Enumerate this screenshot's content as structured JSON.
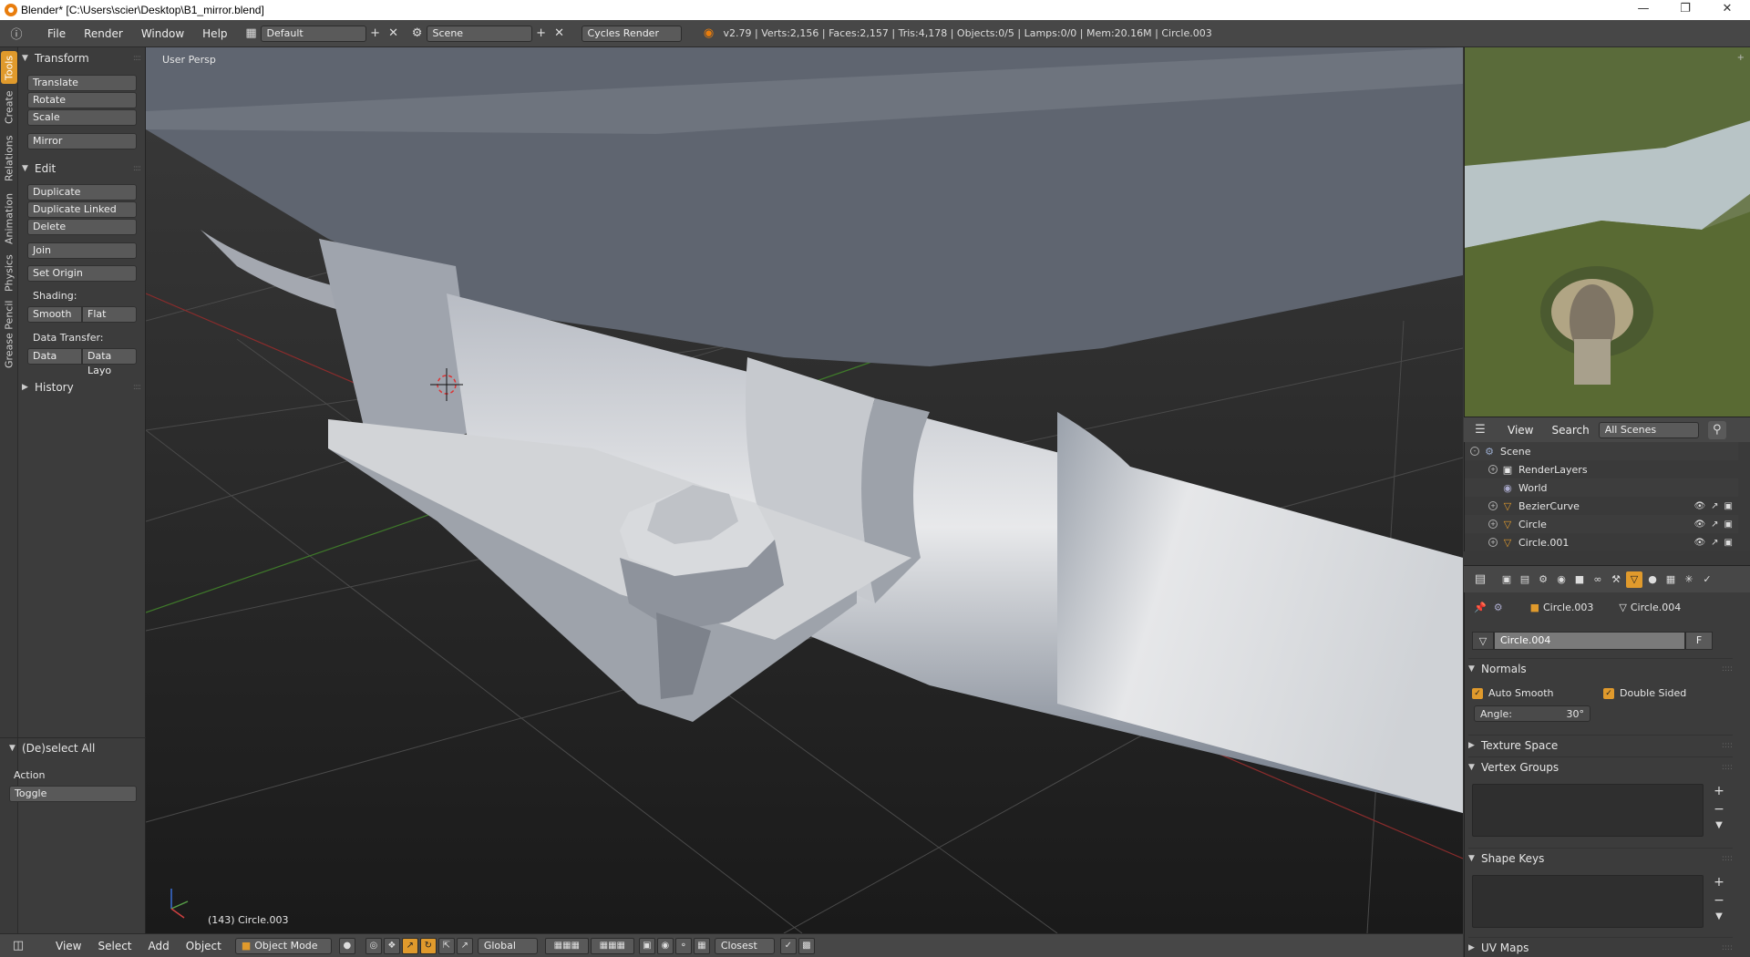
{
  "window": {
    "title": "Blender* [C:\\Users\\scier\\Desktop\\B1_mirror.blend]"
  },
  "infobar": {
    "menus": [
      "File",
      "Render",
      "Window",
      "Help"
    ],
    "layout": "Default",
    "scene": "Scene",
    "engine": "Cycles Render",
    "stats": "v2.79 | Verts:2,156 | Faces:2,157 | Tris:4,178 | Objects:0/5 | Lamps:0/0 | Mem:20.16M | Circle.003"
  },
  "lefttabs": [
    "Tools",
    "Create",
    "Relations",
    "Animation",
    "Physics",
    "Grease Pencil"
  ],
  "toolshelf": {
    "transform": {
      "title": "Transform",
      "buttons": [
        "Translate",
        "Rotate",
        "Scale",
        "Mirror"
      ]
    },
    "edit": {
      "title": "Edit",
      "buttons": [
        "Duplicate",
        "Duplicate Linked",
        "Delete",
        "Join",
        "Set Origin"
      ],
      "shading_label": "Shading:",
      "smooth": "Smooth",
      "flat": "Flat",
      "data_transfer_label": "Data Transfer:",
      "data": "Data",
      "data_layo": "Data Layo"
    },
    "history": {
      "title": "History"
    },
    "operator": {
      "title": "(De)select All",
      "action_label": "Action",
      "action_value": "Toggle"
    }
  },
  "viewport": {
    "view_label": "User Persp",
    "object_label": "(143) Circle.003"
  },
  "bottombar": {
    "menus": [
      "View",
      "Select",
      "Add",
      "Object"
    ],
    "mode": "Object Mode",
    "orientation": "Global",
    "snap": "Closest"
  },
  "outliner": {
    "menus": [
      "View",
      "Search"
    ],
    "filter": "All Scenes",
    "items": [
      {
        "name": "Scene",
        "icon": "scene-icon"
      },
      {
        "name": "RenderLayers",
        "icon": "render-layers-icon"
      },
      {
        "name": "World",
        "icon": "world-icon"
      },
      {
        "name": "BezierCurve",
        "icon": "curve-icon"
      },
      {
        "name": "Circle",
        "icon": "mesh-icon"
      },
      {
        "name": "Circle.001",
        "icon": "mesh-icon"
      }
    ]
  },
  "properties": {
    "breadcrumb_object": "Circle.003",
    "breadcrumb_mesh": "Circle.004",
    "mesh_name": "Circle.004",
    "fake_user": "F",
    "normals": {
      "title": "Normals",
      "auto_smooth": "Auto Smooth",
      "double_sided": "Double Sided",
      "angle_label": "Angle:",
      "angle_value": "30°"
    },
    "sections": [
      "Texture Space",
      "Vertex Groups",
      "Shape Keys",
      "UV Maps"
    ]
  },
  "colors": {
    "accent": "#e09a2c",
    "panel": "#3c3c3c",
    "header": "#474747"
  }
}
